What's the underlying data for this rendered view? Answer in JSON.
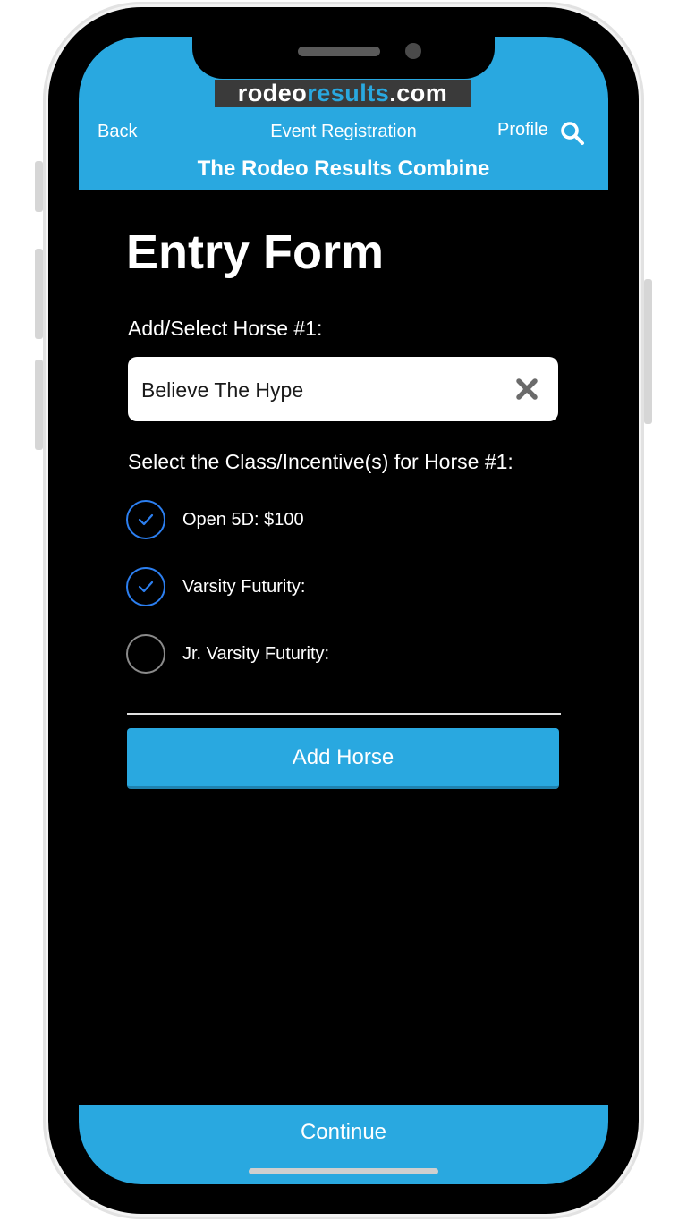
{
  "header": {
    "logo_part1": "rodeo",
    "logo_part2": "results",
    "logo_part3": ".com",
    "back_label": "Back",
    "title": "Event Registration",
    "profile_label": "Profile",
    "event_name": "The Rodeo Results Combine",
    "search_icon": "search-icon"
  },
  "form": {
    "title": "Entry Form",
    "horse_label": "Add/Select Horse #1:",
    "horse_value": "Believe The Hype",
    "clear_icon": "close-icon",
    "class_label": "Select the Class/Incentive(s) for Horse #1:",
    "options": [
      {
        "label": "Open 5D: $100",
        "checked": true
      },
      {
        "label": "Varsity Futurity:",
        "checked": true
      },
      {
        "label": "Jr. Varsity Futurity:",
        "checked": false
      }
    ],
    "add_button": "Add Horse"
  },
  "footer": {
    "continue_label": "Continue"
  },
  "colors": {
    "accent": "#29a8e0",
    "check": "#2c7ff0",
    "background": "#000000"
  }
}
